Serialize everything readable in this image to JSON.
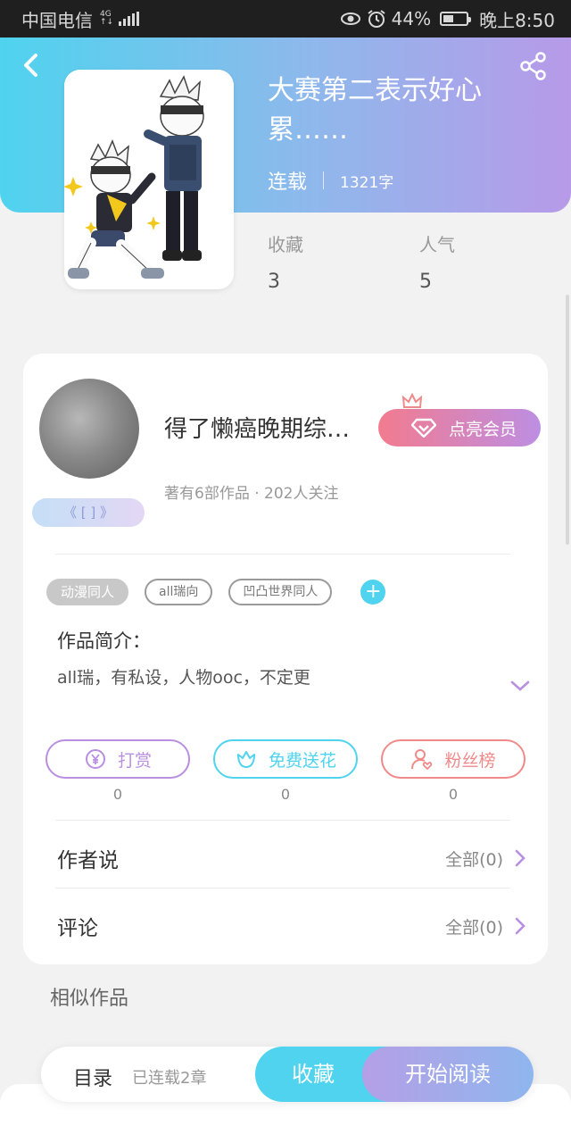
{
  "status_bar": {
    "carrier": "中国电信",
    "network_top": "4G",
    "network_bottom": "↑↓",
    "battery_percent": "44%",
    "battery_level": 0.44,
    "time": "晚上8:50",
    "icons": [
      "eye-icon",
      "alarm-icon",
      "battery-icon",
      "signal-icon"
    ]
  },
  "header": {
    "back_icon": "back-icon",
    "share_icon": "share-icon",
    "title": "大赛第二表示好心累……",
    "status": "连载",
    "word_count": "1321字",
    "stats": [
      {
        "label": "收藏",
        "value": "3"
      },
      {
        "label": "人气",
        "value": "5"
      }
    ]
  },
  "author": {
    "name": "得了懒癌晚期综…",
    "badge": "《 [ ] 》",
    "stats": "著有6部作品 · 202人关注",
    "vip_button": "点亮会员"
  },
  "tags": [
    "动漫同人",
    "all瑞向",
    "凹凸世界同人"
  ],
  "intro": {
    "title": "作品简介：",
    "text": "all瑞，有私设，人物ooc，不定更"
  },
  "actions": [
    {
      "label": "打赏",
      "count": "0",
      "icon": "yen-icon",
      "color": "#b98fe0"
    },
    {
      "label": "免费送花",
      "count": "0",
      "icon": "flower-icon",
      "color": "#4fd3ee"
    },
    {
      "label": "粉丝榜",
      "count": "0",
      "icon": "fan-user-icon",
      "color": "#f08a8a"
    }
  ],
  "sections": [
    {
      "title": "作者说",
      "link": "全部(0)"
    },
    {
      "title": "评论",
      "link": "全部(0)"
    }
  ],
  "similar_title": "相似作品",
  "bottom_bar": {
    "toc": "目录",
    "chapters": "已连载2章",
    "favorite": "收藏",
    "read": "开始阅读"
  },
  "colors": {
    "gradient_start": "#4fd3ee",
    "gradient_end": "#b79ae8",
    "accent_cyan": "#4fd3ee",
    "accent_purple": "#b98fe0",
    "accent_red": "#f08a8a"
  }
}
